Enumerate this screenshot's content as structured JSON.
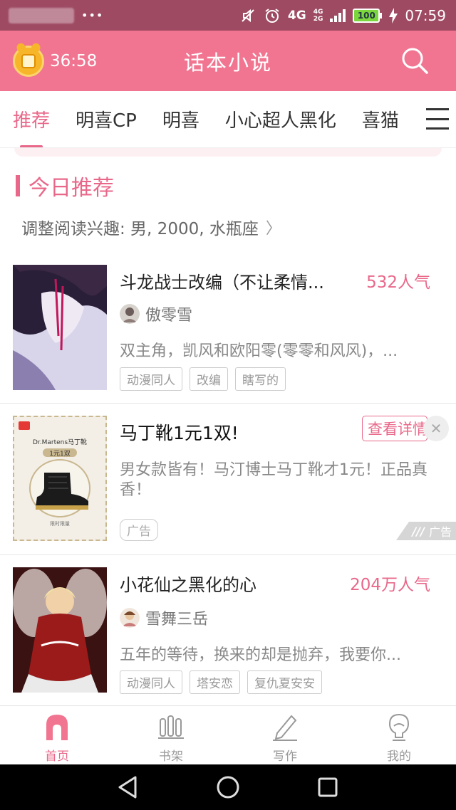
{
  "status_bar": {
    "dots": "•••",
    "network_main": "4G",
    "network_sub_top": "4G",
    "network_sub_bottom": "2G",
    "battery": "100",
    "time": "07:59"
  },
  "header": {
    "timer": "36:58",
    "title": "话本小说"
  },
  "tabs": [
    {
      "label": "推荐",
      "active": true
    },
    {
      "label": "明喜CP",
      "active": false
    },
    {
      "label": "明喜",
      "active": false
    },
    {
      "label": "小心超人黑化",
      "active": false
    },
    {
      "label": "喜猫",
      "active": false
    }
  ],
  "section": {
    "title": "今日推荐",
    "preferences": "调整阅读兴趣: 男, 2000, 水瓶座"
  },
  "books": [
    {
      "title": "斗龙战士改编（不让柔情...",
      "popularity": "532人气",
      "author": "傲零雪",
      "description": "双主角，凯风和欧阳零(零零和风风)，...",
      "tags": [
        "动漫同人",
        "改编",
        "瞎写的"
      ]
    },
    {
      "title": "小花仙之黑化的心",
      "popularity": "204万人气",
      "author": "雪舞三岳",
      "description": "五年的等待，换来的却是抛弃，我要你...",
      "tags": [
        "动漫同人",
        "塔安恋",
        "复仇夏安安"
      ]
    }
  ],
  "ad": {
    "title": "马丁靴1元1双!",
    "cta": "查看详情",
    "close": "✕",
    "description": "男女款皆有！马汀博士马丁靴才1元！正品真香！",
    "tag": "广告",
    "corner_label": "广告",
    "image_brand": "Dr.Martens马丁靴",
    "image_price": "1元1双",
    "image_caption": "限时限量"
  },
  "bottom_nav": [
    {
      "label": "首页",
      "icon": "home-icon",
      "active": true
    },
    {
      "label": "书架",
      "icon": "bookshelf-icon",
      "active": false
    },
    {
      "label": "写作",
      "icon": "pen-icon",
      "active": false
    },
    {
      "label": "我的",
      "icon": "profile-icon",
      "active": false
    }
  ],
  "colors": {
    "accent": "#e9688a",
    "header": "#f17591",
    "status_bar": "#9e4a63"
  }
}
